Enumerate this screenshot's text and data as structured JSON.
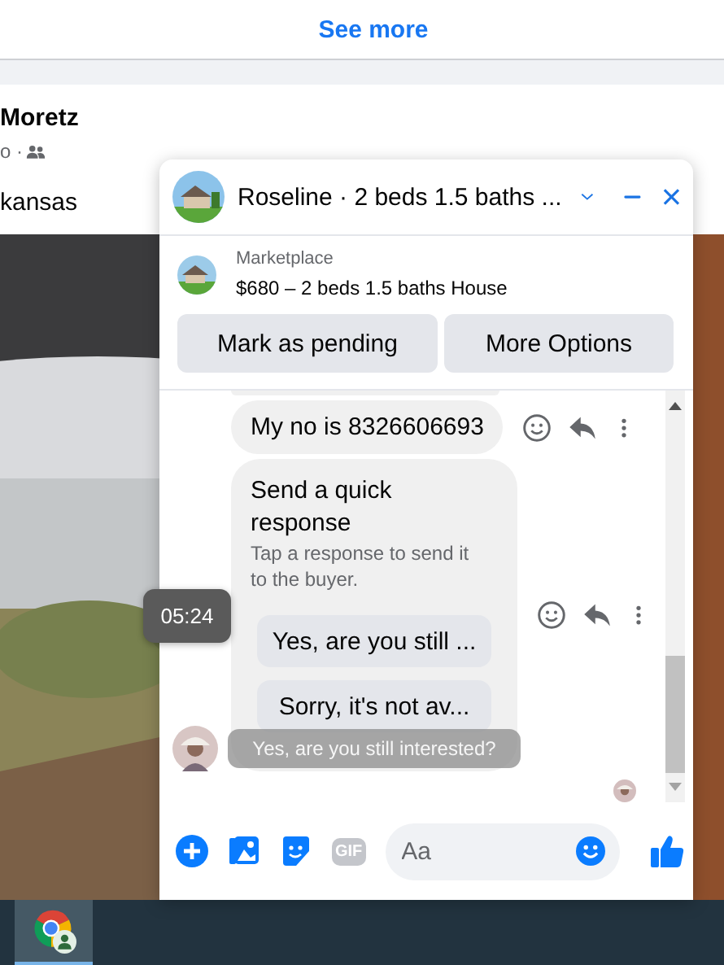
{
  "feed": {
    "see_more": "See more",
    "post": {
      "author": "Moretz",
      "meta": "o ·",
      "location": "kansas"
    }
  },
  "chat": {
    "title": "Roseline · 2 beds 1.5 baths ...",
    "listing": {
      "source": "Marketplace",
      "summary": "$680 – 2 beds 1.5 baths House"
    },
    "actions": [
      "Mark as pending",
      "More Options"
    ],
    "messages": [
      {
        "kind": "text",
        "text": "My no is 8326606693"
      },
      {
        "kind": "quick_response",
        "title": "Send a quick response",
        "subtitle": "Tap a response to send it to the buyer.",
        "options": [
          "Yes, are you still ...",
          "Sorry, it's not av..."
        ]
      }
    ],
    "timestamp_tooltip": "05:24",
    "hover_tooltip": "Yes, are you still interested?",
    "composer": {
      "placeholder": "Aa",
      "gif_label": "GIF"
    }
  },
  "taskbar": {
    "items": [
      {
        "selected": true
      }
    ]
  }
}
